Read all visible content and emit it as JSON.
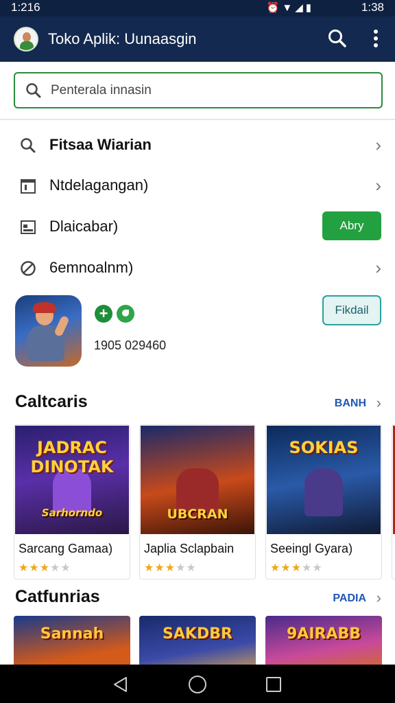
{
  "status_bar": {
    "time_left": "1:216",
    "icons": "⏰▼◢▮",
    "time_right": "1:38"
  },
  "app_bar": {
    "title": "Toko Aplik: Uunaasgin",
    "search_icon": "search-icon",
    "more_icon": "more-vert-icon"
  },
  "search": {
    "placeholder": "Penterala innasin"
  },
  "menu": [
    {
      "label": "Fitsaa Wiarian",
      "icon": "search-icon",
      "trailing": "chevron"
    },
    {
      "label": "Ntdelagangan)",
      "icon": "calendar-icon",
      "trailing": "chevron"
    },
    {
      "label": "Dlaicabar)",
      "icon": "image-icon",
      "trailing": "button",
      "button_label": "Abry"
    },
    {
      "label": "6emnoalnm)",
      "icon": "block-icon",
      "trailing": "chevron"
    }
  ],
  "featured": {
    "number": "1905 029460",
    "button_label": "Fikdail"
  },
  "sections": [
    {
      "title": "Caltcaris",
      "link": "BANH",
      "games": [
        {
          "name": "Sarcang Gamaa)",
          "thumb_text": "JADRAC DINOTAK",
          "thumb_subtext": "Sarhorndo",
          "rating": 3
        },
        {
          "name": "Japlia Sclapbain",
          "thumb_text": "",
          "thumb_subtext": "UBCRAN",
          "rating": 3
        },
        {
          "name": "Seeingl Gyara)",
          "thumb_text": "SOKIAS",
          "thumb_subtext": "",
          "rating": 3
        }
      ]
    },
    {
      "title": "Catfunrias",
      "link": "PADIA",
      "games": [
        {
          "thumb_text": "Sannah"
        },
        {
          "thumb_text": "SAKDBR"
        },
        {
          "thumb_text": "9AIRABB"
        }
      ]
    }
  ],
  "nav_bar": {
    "back_icon": "back-icon",
    "home_icon": "home-icon",
    "recent_icon": "recent-apps-icon"
  },
  "colors": {
    "app_bar": "#13294f",
    "status_bar": "#0f2140",
    "accent_green": "#23a040",
    "link_blue": "#1e57b4",
    "star": "#f0a818"
  }
}
